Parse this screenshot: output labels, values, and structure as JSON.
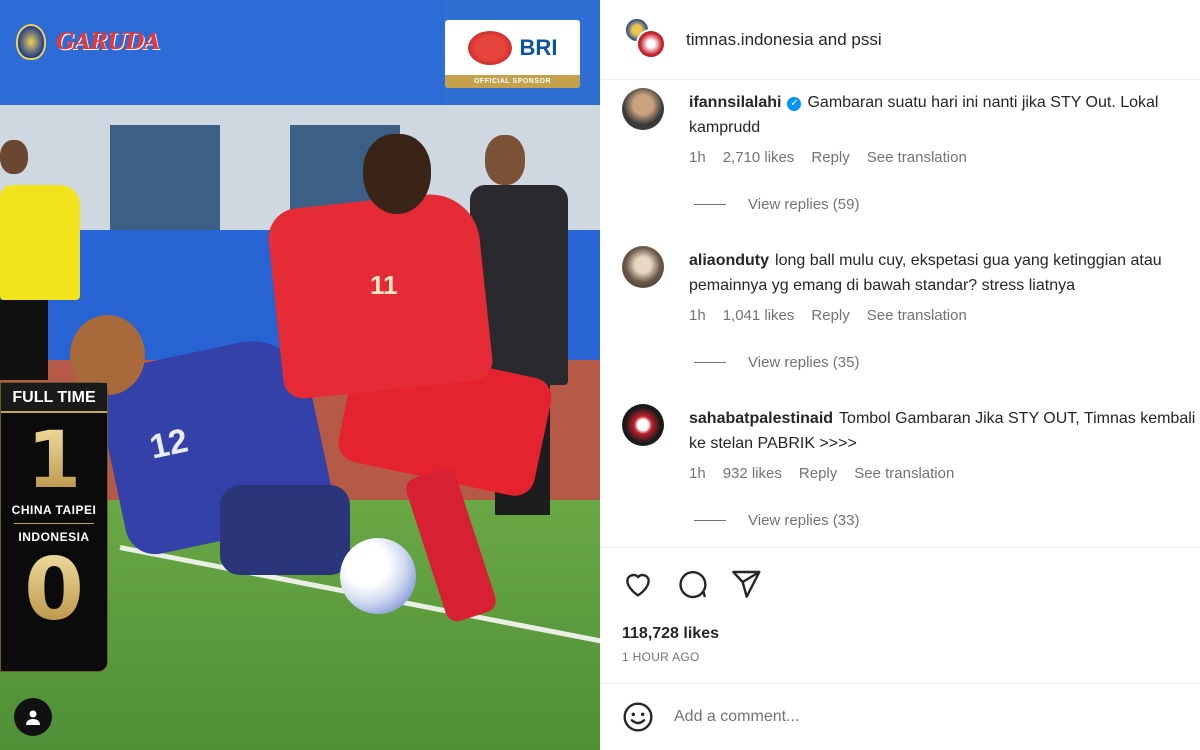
{
  "post_image": {
    "brand_text": "GARUDA",
    "sponsor_name": "BRI",
    "sponsor_caption": "OFFICIAL SPONSOR",
    "scoreboard": {
      "status": "FULL TIME",
      "home_score": "1",
      "home_team": "CHINA TAIPEI",
      "away_team": "INDONESIA",
      "away_score": "0"
    },
    "jersey_red": "11",
    "jersey_blue": "12"
  },
  "header": {
    "title": "timnas.indonesia and pssi"
  },
  "comments": [
    {
      "user": "ifannsilalahi",
      "verified": true,
      "text": "Gambaran suatu hari ini nanti jika STY Out. Lokal kamprudd",
      "time": "1h",
      "likes": "2,710 likes",
      "reply": "Reply",
      "translate": "See translation",
      "view_replies": "View replies (59)"
    },
    {
      "user": "aliaonduty",
      "verified": false,
      "text": "long ball mulu cuy, ekspetasi gua yang ketinggian atau pemainnya yg emang di bawah standar? stress liatnya",
      "time": "1h",
      "likes": "1,041 likes",
      "reply": "Reply",
      "translate": "See translation",
      "view_replies": "View replies (35)"
    },
    {
      "user": "sahabatpalestinaid",
      "verified": false,
      "text": "Tombol Gambaran Jika STY OUT, Timnas kembali ke stelan PABRIK >>>>",
      "time": "1h",
      "likes": "932 likes",
      "reply": "Reply",
      "translate": "See translation",
      "view_replies": "View replies (33)"
    }
  ],
  "actions": {
    "icons": [
      "heart-icon",
      "comment-icon",
      "share-icon"
    ]
  },
  "post_likes": "118,728 likes",
  "post_time": "1 HOUR AGO",
  "add_comment": {
    "placeholder": "Add a comment..."
  },
  "colors": {
    "verified": "#0095f6",
    "meta_text": "#737373",
    "primary_text": "#262626"
  }
}
